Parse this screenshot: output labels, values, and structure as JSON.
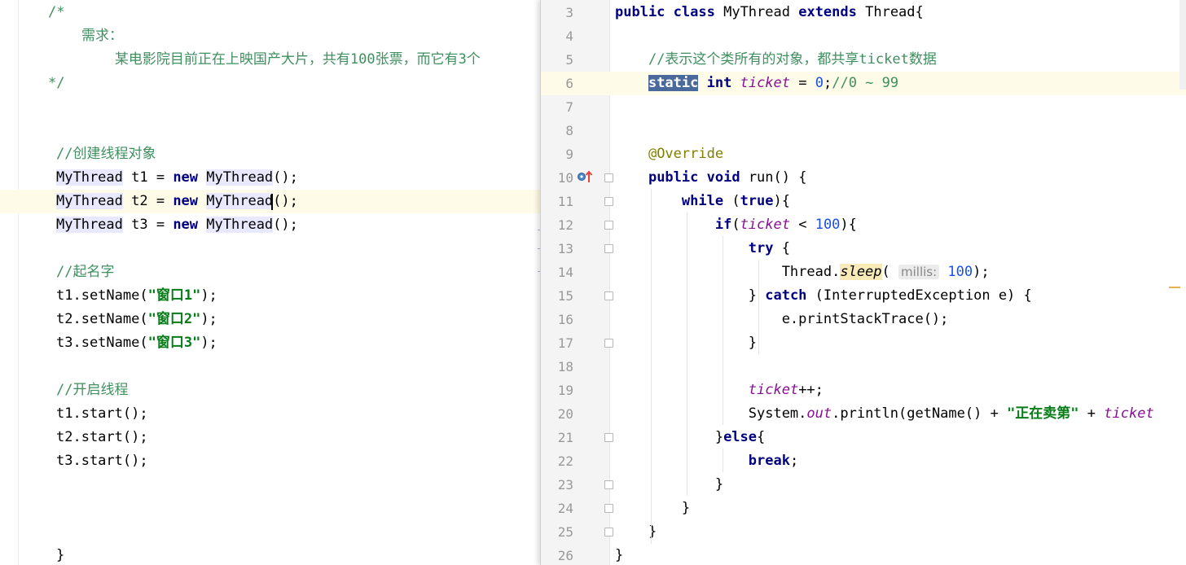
{
  "left_editor": {
    "lines": [
      [
        {
          "t": "/*",
          "c": "cmg"
        }
      ],
      [
        {
          "t": "    需求：",
          "c": "cmg"
        }
      ],
      [
        {
          "t": "        某电影院目前正在上映国产大片，共有100张票，而它有3个",
          "c": "cmg"
        }
      ],
      [
        {
          "t": "*/",
          "c": "cmg"
        }
      ],
      [],
      [],
      [
        {
          "t": "//创建线程对象",
          "c": "cmg"
        }
      ],
      [
        {
          "t": "MyThread",
          "c": "hl-class"
        },
        {
          "t": " t1 = "
        },
        {
          "t": "new",
          "c": "kw"
        },
        {
          "t": " "
        },
        {
          "t": "MyThread",
          "c": "hl-class"
        },
        {
          "t": "();"
        }
      ],
      [
        {
          "t": "MyThread",
          "c": "hl-class"
        },
        {
          "t": " t2 = "
        },
        {
          "t": "new",
          "c": "kw"
        },
        {
          "t": " "
        },
        {
          "t": "MyThread",
          "c": "hl-class"
        },
        {
          "t": "();"
        }
      ],
      [
        {
          "t": "MyThread",
          "c": "hl-class"
        },
        {
          "t": " t3 = "
        },
        {
          "t": "new",
          "c": "kw"
        },
        {
          "t": " "
        },
        {
          "t": "MyThread",
          "c": "hl-class"
        },
        {
          "t": "();"
        }
      ],
      [],
      [
        {
          "t": "//起名字",
          "c": "cmg"
        }
      ],
      [
        {
          "t": "t1.setName("
        },
        {
          "t": "\"窗口1\"",
          "c": "str"
        },
        {
          "t": ");"
        }
      ],
      [
        {
          "t": "t2.setName("
        },
        {
          "t": "\"窗口2\"",
          "c": "str"
        },
        {
          "t": ");"
        }
      ],
      [
        {
          "t": "t3.setName("
        },
        {
          "t": "\"窗口3\"",
          "c": "str"
        },
        {
          "t": ");"
        }
      ],
      [],
      [
        {
          "t": "//开启线程",
          "c": "cmg"
        }
      ],
      [
        {
          "t": "t1.start();"
        }
      ],
      [
        {
          "t": "t2.start();"
        }
      ],
      [
        {
          "t": "t3.start();"
        }
      ],
      [],
      [],
      [],
      [
        {
          "t": "}"
        }
      ]
    ]
  },
  "right_editor": {
    "line_numbers": [
      "3",
      "4",
      "5",
      "6",
      "7",
      "8",
      "9",
      "10",
      "11",
      "12",
      "13",
      "14",
      "15",
      "16",
      "17",
      "18",
      "19",
      "20",
      "21",
      "22",
      "23",
      "24",
      "25",
      "26"
    ],
    "lines": [
      [
        {
          "t": "public",
          "c": "kw"
        },
        {
          "t": " "
        },
        {
          "t": "class",
          "c": "kw"
        },
        {
          "t": " MyThread "
        },
        {
          "t": "extends",
          "c": "kw"
        },
        {
          "t": " Thread{"
        }
      ],
      [],
      [
        {
          "t": "    "
        },
        {
          "t": "//表示这个类所有的对象，都共享ticket数据",
          "c": "cmg"
        }
      ],
      [
        {
          "t": "    "
        },
        {
          "t": "static",
          "c": "hl-sel kw"
        },
        {
          "t": " "
        },
        {
          "t": "int",
          "c": "kw"
        },
        {
          "t": " "
        },
        {
          "t": "ticket",
          "c": "fld"
        },
        {
          "t": " = "
        },
        {
          "t": "0",
          "c": "num"
        },
        {
          "t": ";"
        },
        {
          "t": "//0 ~ 99",
          "c": "cmg"
        }
      ],
      [],
      [],
      [
        {
          "t": "    "
        },
        {
          "t": "@Override",
          "c": "ann"
        }
      ],
      [
        {
          "t": "    "
        },
        {
          "t": "public",
          "c": "kw"
        },
        {
          "t": " "
        },
        {
          "t": "void",
          "c": "kw"
        },
        {
          "t": " run() {"
        }
      ],
      [
        {
          "t": "        "
        },
        {
          "t": "while",
          "c": "kw"
        },
        {
          "t": " ("
        },
        {
          "t": "true",
          "c": "kw"
        },
        {
          "t": "){"
        }
      ],
      [
        {
          "t": "            "
        },
        {
          "t": "if",
          "c": "kw"
        },
        {
          "t": "("
        },
        {
          "t": "ticket",
          "c": "fld"
        },
        {
          "t": " < "
        },
        {
          "t": "100",
          "c": "num"
        },
        {
          "t": "){"
        }
      ],
      [
        {
          "t": "                "
        },
        {
          "t": "try",
          "c": "kw"
        },
        {
          "t": " {"
        }
      ],
      [
        {
          "t": "                    Thread."
        },
        {
          "t": "sleep",
          "c": "hl-sleep"
        },
        {
          "t": "( "
        },
        {
          "t": "millis:",
          "c": "hint"
        },
        {
          "t": " "
        },
        {
          "t": "100",
          "c": "num"
        },
        {
          "t": ");"
        }
      ],
      [
        {
          "t": "                } "
        },
        {
          "t": "catch",
          "c": "kw"
        },
        {
          "t": " (InterruptedException e) {"
        }
      ],
      [
        {
          "t": "                    e.printStackTrace();"
        }
      ],
      [
        {
          "t": "                }"
        }
      ],
      [],
      [
        {
          "t": "                "
        },
        {
          "t": "ticket",
          "c": "fld"
        },
        {
          "t": "++;"
        }
      ],
      [
        {
          "t": "                System."
        },
        {
          "t": "out",
          "c": "stat-m"
        },
        {
          "t": ".println(getName() + "
        },
        {
          "t": "\"正在卖第\"",
          "c": "str"
        },
        {
          "t": " + "
        },
        {
          "t": "ticket",
          "c": "fld"
        }
      ],
      [
        {
          "t": "            }"
        },
        {
          "t": "else",
          "c": "kw"
        },
        {
          "t": "{"
        }
      ],
      [
        {
          "t": "                "
        },
        {
          "t": "break",
          "c": "kw"
        },
        {
          "t": ";"
        }
      ],
      [
        {
          "t": "            }"
        }
      ],
      [
        {
          "t": "        }"
        }
      ],
      [
        {
          "t": "    }"
        }
      ],
      [
        {
          "t": "}"
        }
      ]
    ]
  },
  "colors": {
    "keyword": "#000080",
    "comment": "#3f8f5f",
    "string": "#067d17",
    "number": "#1750eb",
    "annotation": "#808000",
    "field": "#871094",
    "current_line": "#fefbe8"
  },
  "icons": {
    "breakpoint": "override-run-icon",
    "fold": "fold-marker-icon"
  }
}
